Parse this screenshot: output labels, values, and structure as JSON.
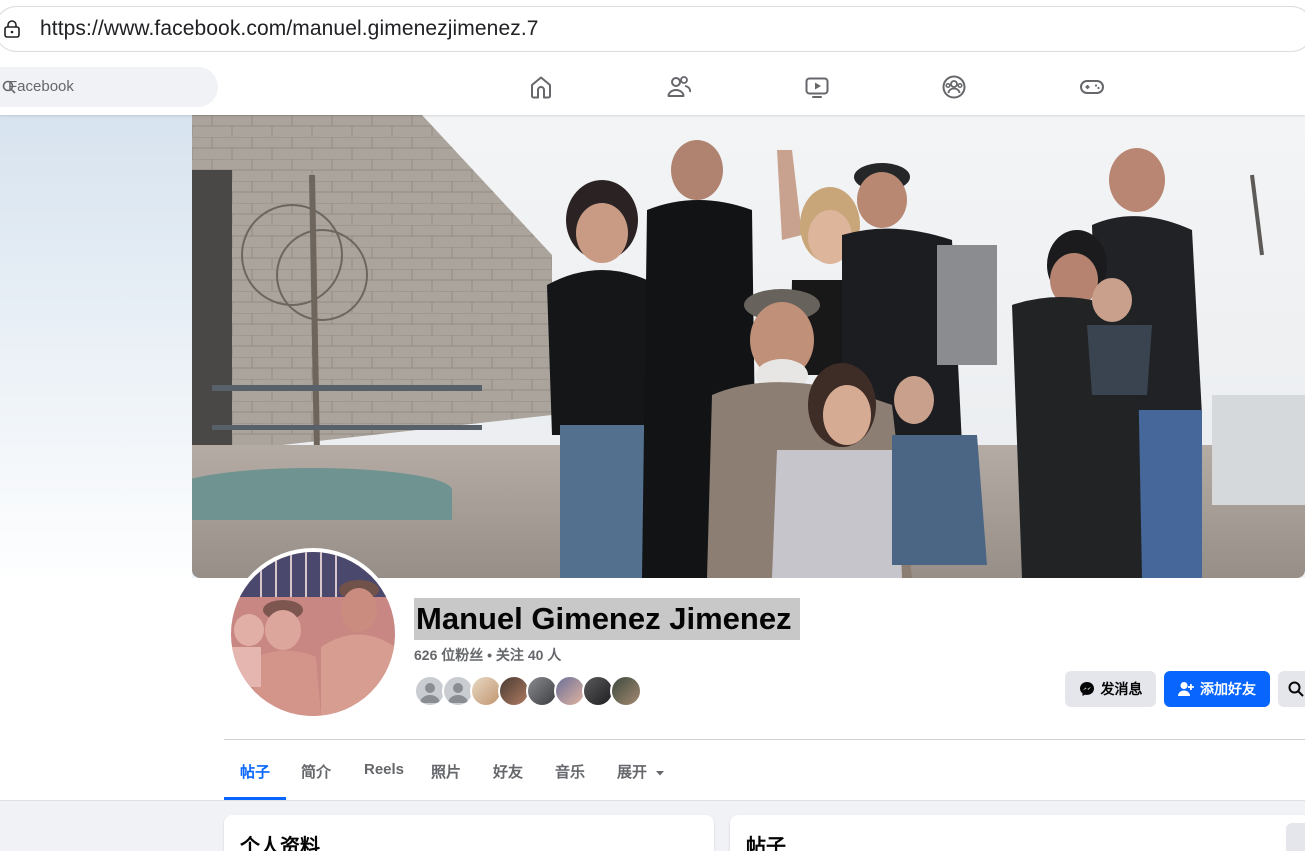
{
  "browser": {
    "url": "https://www.facebook.com/manuel.gimenezjimenez.7"
  },
  "nav": {
    "search_placeholder": "Facebook",
    "icons": [
      "home-icon",
      "friends-icon",
      "video-icon",
      "groups-icon",
      "gaming-icon"
    ]
  },
  "profile": {
    "name": "Manuel Gimenez Jimenez",
    "stats": "626 位粉丝 • 关注 40 人",
    "message_label": "发消息",
    "add_friend_label": "添加好友"
  },
  "tabs": [
    {
      "label": "帖子",
      "active": true
    },
    {
      "label": "简介",
      "active": false
    },
    {
      "label": "Reels",
      "active": false
    },
    {
      "label": "照片",
      "active": false
    },
    {
      "label": "好友",
      "active": false
    },
    {
      "label": "音乐",
      "active": false
    },
    {
      "label": "展开",
      "active": false
    }
  ],
  "cards": {
    "intro_title": "个人资料",
    "posts_title": "帖子"
  },
  "colors": {
    "accent": "#0866ff",
    "secondary_button": "#e4e6eb",
    "page_bg": "#f0f2f5"
  }
}
